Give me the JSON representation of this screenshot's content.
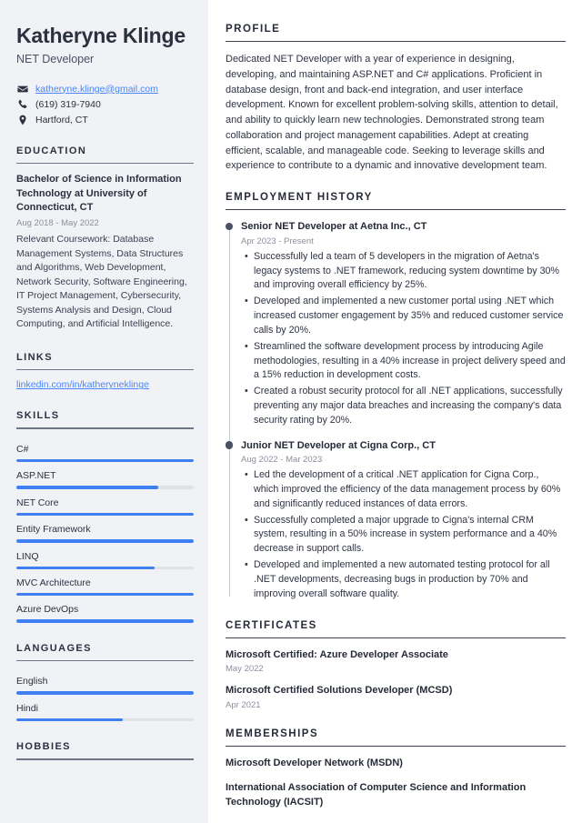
{
  "colors": {
    "accent_blue": "#3f7ff2",
    "link_blue": "#4a86f7",
    "sidebar_bg": "#f1f2f6",
    "heading_dark": "#262b38",
    "muted_gray": "#8b909d",
    "timeline_dot": "#4a5163"
  },
  "sidebar": {
    "name": "Katheryne Klinge",
    "job_title": "NET Developer",
    "contact": {
      "email": "katheryne.klinge@gmail.com",
      "phone": "(619) 319-7940",
      "location": "Hartford, CT",
      "email_icon": "envelope-icon",
      "phone_icon": "phone-icon",
      "location_icon": "map-pin-icon"
    },
    "education": {
      "heading": "EDUCATION",
      "degree": "Bachelor of Science in Information Technology at University of Connecticut, CT",
      "dates": "Aug 2018 - May 2022",
      "description": "Relevant Coursework: Database Management Systems, Data Structures and Algorithms, Web Development, Network Security, Software Engineering, IT Project Management, Cybersecurity, Systems Analysis and Design, Cloud Computing, and Artificial Intelligence."
    },
    "links": {
      "heading": "LINKS",
      "items": [
        {
          "label": "linkedin.com/in/katheryneklinge"
        }
      ]
    },
    "skills": {
      "heading": "SKILLS",
      "items": [
        {
          "label": "C#",
          "level": 100
        },
        {
          "label": "ASP.NET",
          "level": 80
        },
        {
          "label": "NET Core",
          "level": 100
        },
        {
          "label": "Entity Framework",
          "level": 100
        },
        {
          "label": "LINQ",
          "level": 78
        },
        {
          "label": "MVC Architecture",
          "level": 100
        },
        {
          "label": "Azure DevOps",
          "level": 100
        }
      ]
    },
    "languages": {
      "heading": "LANGUAGES",
      "items": [
        {
          "label": "English",
          "level": 100
        },
        {
          "label": "Hindi",
          "level": 60
        }
      ]
    },
    "hobbies": {
      "heading": "HOBBIES"
    }
  },
  "main": {
    "profile": {
      "heading": "PROFILE",
      "text": "Dedicated NET Developer with a year of experience in designing, developing, and maintaining ASP.NET and C# applications. Proficient in database design, front and back-end integration, and user interface development. Known for excellent problem-solving skills, attention to detail, and ability to quickly learn new technologies. Demonstrated strong team collaboration and project management capabilities. Adept at creating efficient, scalable, and manageable code. Seeking to leverage skills and experience to contribute to a dynamic and innovative development team."
    },
    "employment": {
      "heading": "EMPLOYMENT HISTORY",
      "jobs": [
        {
          "role": "Senior NET Developer at Aetna Inc., CT",
          "dates": "Apr 2023 - Present",
          "bullets": [
            "Successfully led a team of 5 developers in the migration of Aetna's legacy systems to .NET framework, reducing system downtime by 30% and improving overall efficiency by 25%.",
            "Developed and implemented a new customer portal using .NET which increased customer engagement by 35% and reduced customer service calls by 20%.",
            "Streamlined the software development process by introducing Agile methodologies, resulting in a 40% increase in project delivery speed and a 15% reduction in development costs.",
            "Created a robust security protocol for all .NET applications, successfully preventing any major data breaches and increasing the company's data security rating by 20%."
          ]
        },
        {
          "role": "Junior NET Developer at Cigna Corp., CT",
          "dates": "Aug 2022 - Mar 2023",
          "bullets": [
            "Led the development of a critical .NET application for Cigna Corp., which improved the efficiency of the data management process by 60% and significantly reduced instances of data errors.",
            "Successfully completed a major upgrade to Cigna's internal CRM system, resulting in a 50% increase in system performance and a 40% decrease in support calls.",
            "Developed and implemented a new automated testing protocol for all .NET developments, decreasing bugs in production by 70% and improving overall software quality."
          ]
        }
      ]
    },
    "certificates": {
      "heading": "CERTIFICATES",
      "items": [
        {
          "title": "Microsoft Certified: Azure Developer Associate",
          "date": "May 2022"
        },
        {
          "title": "Microsoft Certified Solutions Developer (MCSD)",
          "date": "Apr 2021"
        }
      ]
    },
    "memberships": {
      "heading": "MEMBERSHIPS",
      "items": [
        {
          "title": "Microsoft Developer Network (MSDN)"
        },
        {
          "title": "International Association of Computer Science and Information Technology (IACSIT)"
        }
      ]
    }
  }
}
